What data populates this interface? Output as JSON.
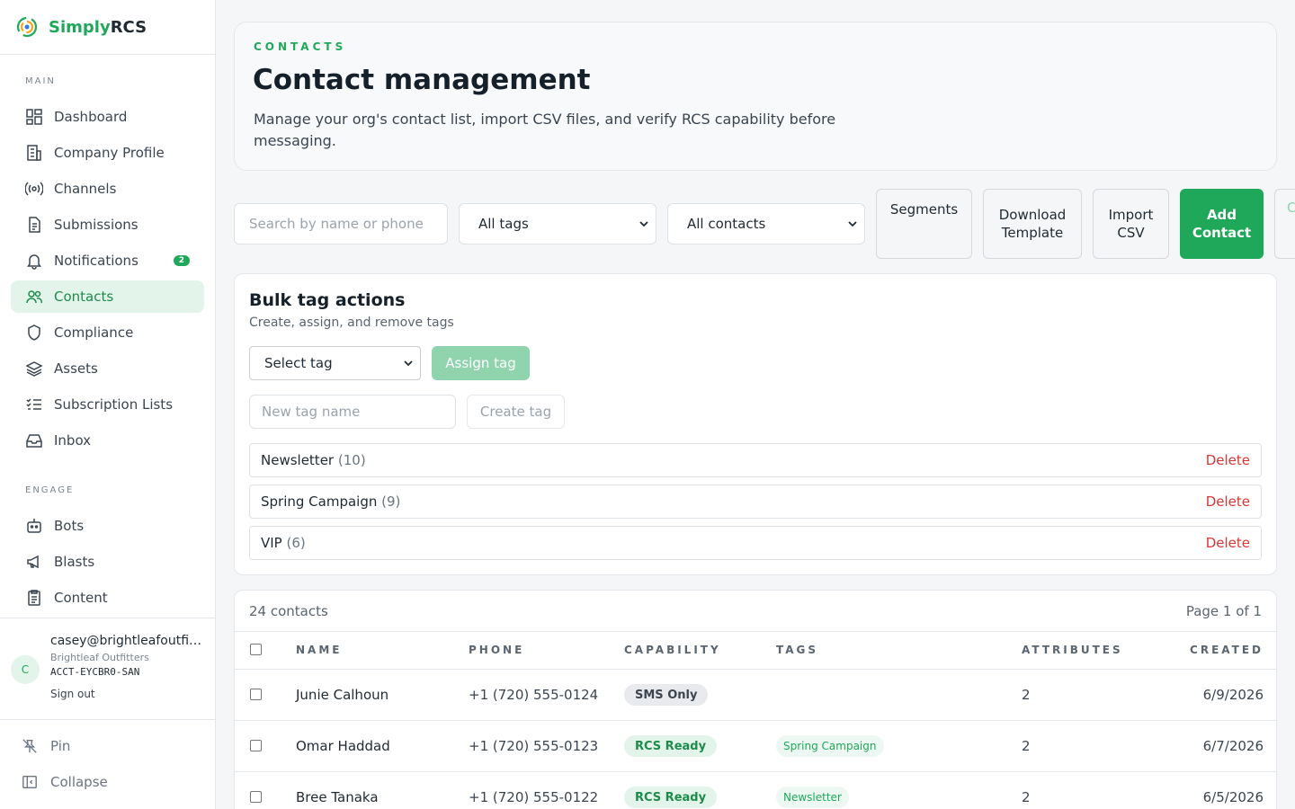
{
  "brand": {
    "part1": "Simply",
    "part2": "RCS"
  },
  "sidebar": {
    "main_label": "MAIN",
    "engage_label": "ENGAGE",
    "main_items": [
      {
        "label": "Dashboard",
        "icon": "dashboard-icon"
      },
      {
        "label": "Company Profile",
        "icon": "building-icon"
      },
      {
        "label": "Channels",
        "icon": "broadcast-icon"
      },
      {
        "label": "Submissions",
        "icon": "document-icon"
      },
      {
        "label": "Notifications",
        "icon": "bell-icon",
        "badge": "2"
      },
      {
        "label": "Contacts",
        "icon": "users-icon",
        "active": true
      },
      {
        "label": "Compliance",
        "icon": "shield-icon"
      },
      {
        "label": "Assets",
        "icon": "layers-icon"
      },
      {
        "label": "Subscription Lists",
        "icon": "checklist-icon"
      },
      {
        "label": "Inbox",
        "icon": "inbox-icon"
      }
    ],
    "engage_items": [
      {
        "label": "Bots",
        "icon": "bot-icon"
      },
      {
        "label": "Blasts",
        "icon": "megaphone-icon"
      },
      {
        "label": "Content",
        "icon": "clipboard-icon"
      }
    ],
    "user": {
      "initial": "C",
      "email": "casey@brightleafoutfitters.com",
      "org": "Brightleaf Outfitters",
      "account": "ACCT-EYCBR0-SAN",
      "signout": "Sign out"
    },
    "pin": "Pin",
    "collapse": "Collapse"
  },
  "header": {
    "eyebrow": "CONTACTS",
    "title": "Contact management",
    "description": "Manage your org's contact list, import CSV files, and verify RCS capability before messaging."
  },
  "toolbar": {
    "search_placeholder": "Search by name or phone",
    "tag_filter": "All tags",
    "contact_filter": "All contacts",
    "segments": "Segments",
    "download_template": "Download Template",
    "import_csv": "Import CSV",
    "add_contact": "Add Contact",
    "clipped": "C"
  },
  "bulk": {
    "title": "Bulk tag actions",
    "subtitle": "Create, assign, and remove tags",
    "select_placeholder": "Select tag",
    "assign_label": "Assign tag",
    "new_tag_placeholder": "New tag name",
    "create_label": "Create tag",
    "delete_label": "Delete",
    "tags": [
      {
        "name": "Newsletter",
        "count": "(10)"
      },
      {
        "name": "Spring Campaign",
        "count": "(9)"
      },
      {
        "name": "VIP",
        "count": "(6)"
      }
    ]
  },
  "table": {
    "total": "24 contacts",
    "page": "Page 1 of 1",
    "columns": [
      "NAME",
      "PHONE",
      "CAPABILITY",
      "TAGS",
      "ATTRIBUTES",
      "CREATED"
    ],
    "rows": [
      {
        "name": "Junie Calhoun",
        "phone": "+1 (720) 555-0124",
        "capability": "SMS Only",
        "tag": "",
        "attributes": "2",
        "created": "6/9/2026"
      },
      {
        "name": "Omar Haddad",
        "phone": "+1 (720) 555-0123",
        "capability": "RCS Ready",
        "tag": "Spring Campaign",
        "attributes": "2",
        "created": "6/7/2026"
      },
      {
        "name": "Bree Tanaka",
        "phone": "+1 (720) 555-0122",
        "capability": "RCS Ready",
        "tag": "Newsletter",
        "attributes": "2",
        "created": "6/5/2026"
      }
    ]
  },
  "colors": {
    "accent": "#1fa85a",
    "danger": "#d93636"
  }
}
